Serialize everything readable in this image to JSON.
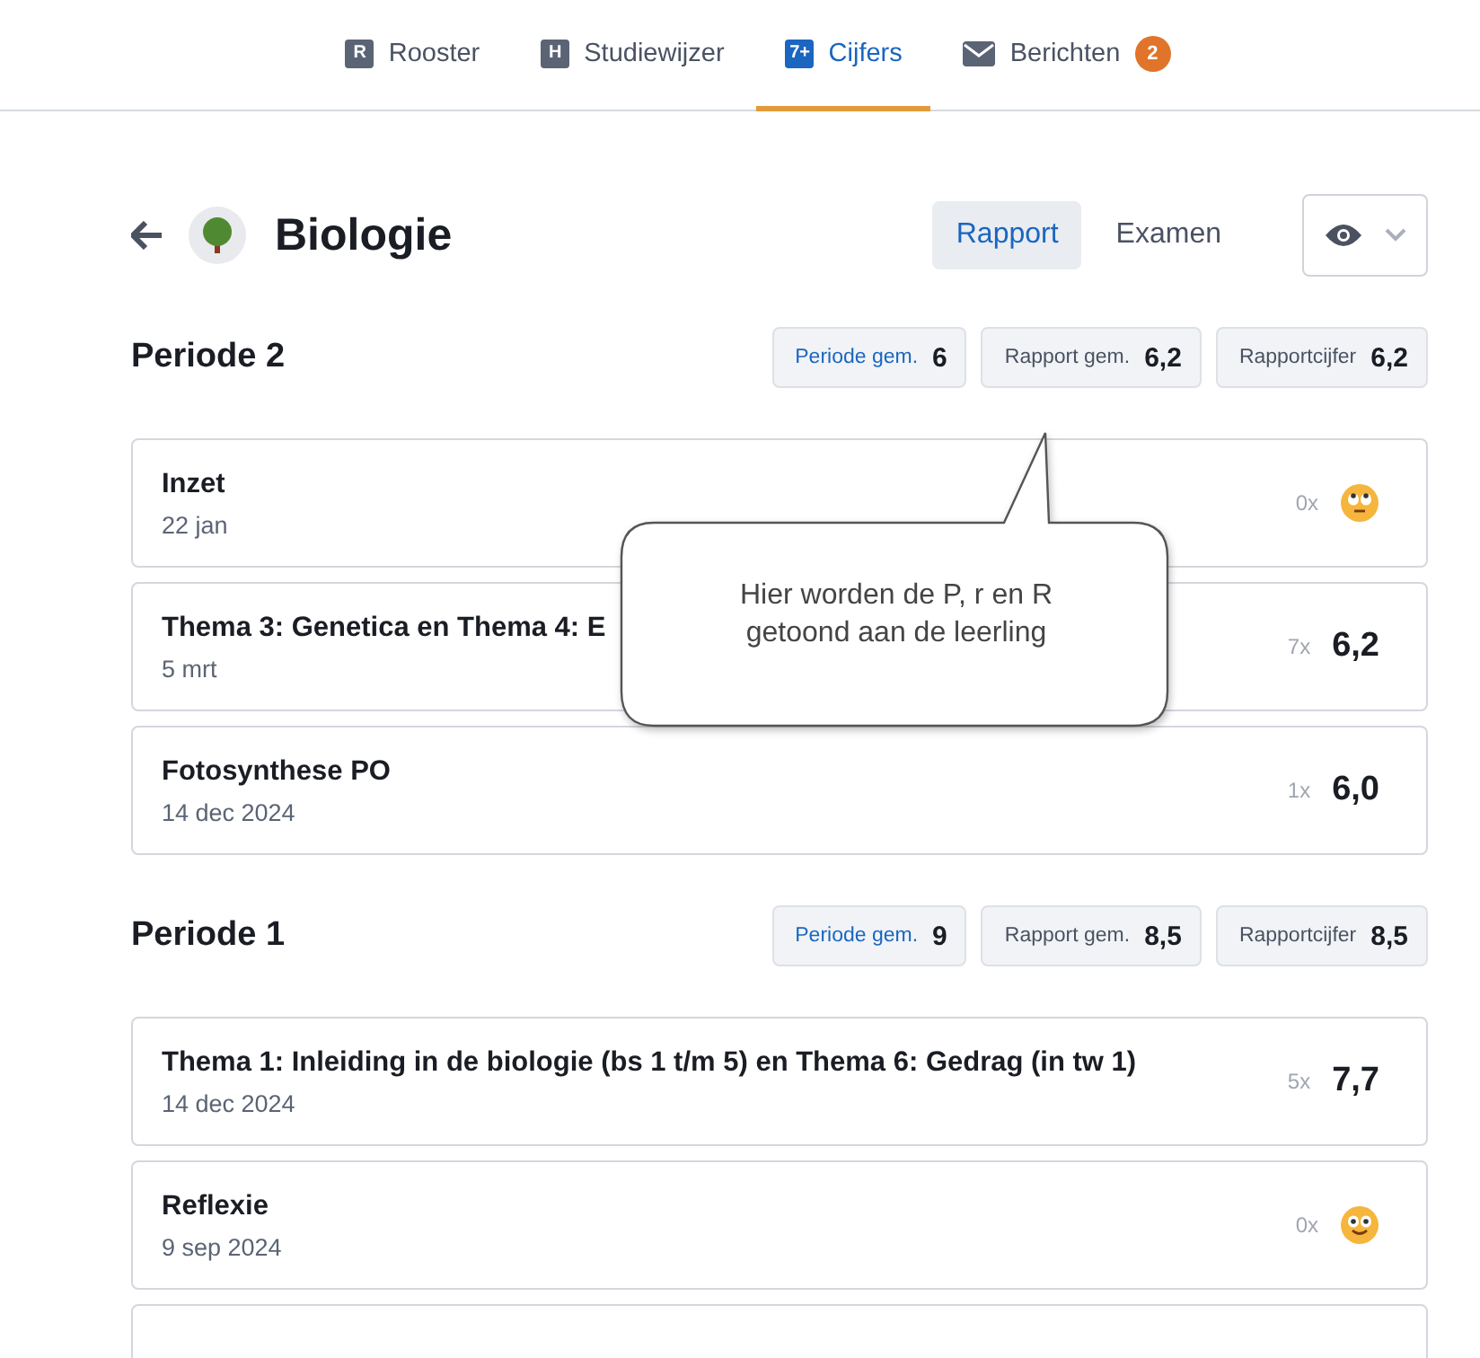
{
  "nav": {
    "tabs": [
      {
        "label": "Rooster",
        "kind": "glyph",
        "icon": "R",
        "selected": false
      },
      {
        "label": "Studiewijzer",
        "kind": "glyph",
        "icon": "H",
        "selected": false
      },
      {
        "label": "Cijfers",
        "kind": "glyph",
        "icon": "7+",
        "selected": true
      },
      {
        "label": "Berichten",
        "kind": "mail",
        "selected": false,
        "badge": "2"
      }
    ]
  },
  "header": {
    "title": "Biologie",
    "views": [
      {
        "label": "Rapport",
        "selected": true
      },
      {
        "label": "Examen",
        "selected": false
      }
    ]
  },
  "periods": [
    {
      "title": "Periode 2",
      "stats": [
        {
          "label": "Periode gem.",
          "value": "6",
          "selected": true
        },
        {
          "label": "Rapport gem.",
          "value": "6,2",
          "selected": false
        },
        {
          "label": "Rapportcijfer",
          "value": "6,2",
          "selected": false
        }
      ],
      "grades": [
        {
          "title": "Inzet",
          "date": "22 jan",
          "count": "0x",
          "kind": "eyeroll"
        },
        {
          "title": "Thema 3: Genetica en Thema 4: E",
          "date": "5 mrt",
          "count": "7x",
          "kind": "grade",
          "value": "6,2"
        },
        {
          "title": "Fotosynthese PO",
          "date": "14 dec 2024",
          "count": "1x",
          "kind": "grade",
          "value": "6,0"
        }
      ]
    },
    {
      "title": "Periode 1",
      "stats": [
        {
          "label": "Periode gem.",
          "value": "9",
          "selected": true
        },
        {
          "label": "Rapport gem.",
          "value": "8,5",
          "selected": false
        },
        {
          "label": "Rapportcijfer",
          "value": "8,5",
          "selected": false
        }
      ],
      "grades": [
        {
          "title": "Thema 1: Inleiding in de biologie (bs 1 t/m 5) en Thema 6: Gedrag (in tw 1)",
          "date": "14 dec 2024",
          "count": "5x",
          "kind": "grade",
          "value": "7,7"
        },
        {
          "title": "Reflexie",
          "date": "9 sep 2024",
          "count": "0x",
          "kind": "smile"
        },
        {
          "kind": "partial"
        }
      ]
    }
  ],
  "callout": {
    "text": "Hier worden de P, r en R getoond aan de leerling"
  }
}
